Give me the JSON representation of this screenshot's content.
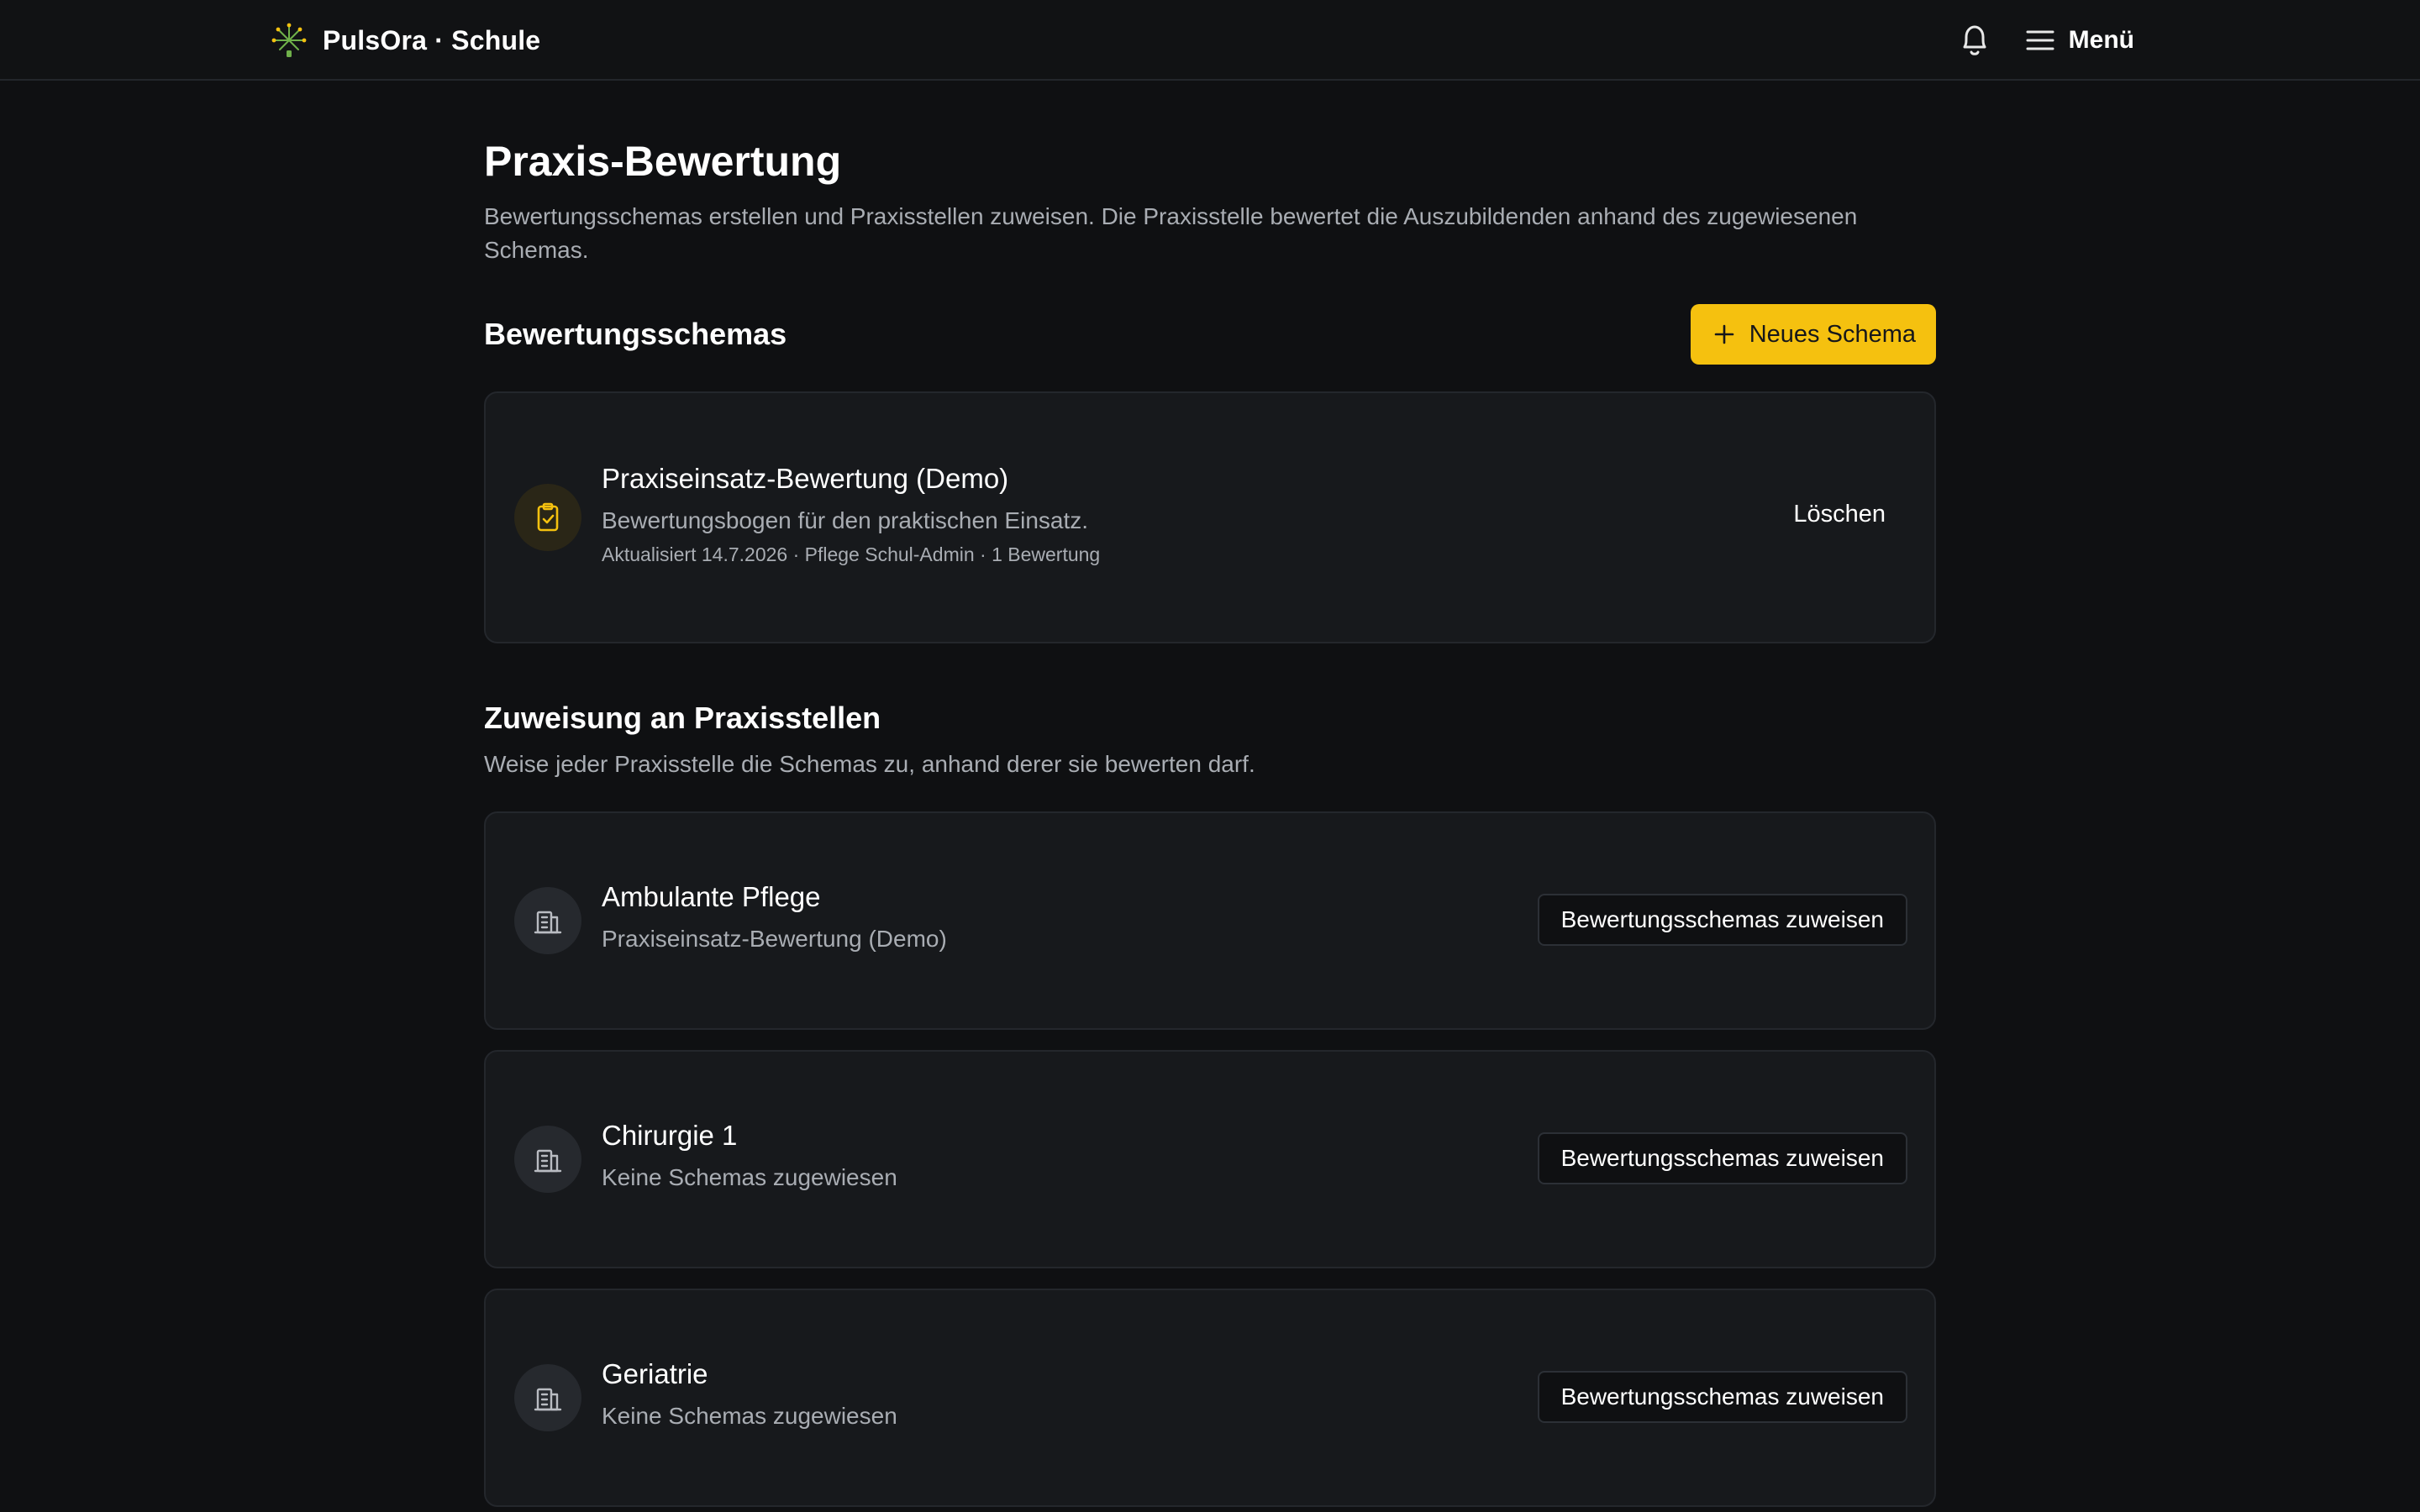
{
  "header": {
    "brand": "PulsOra · Schule",
    "notifications_icon": "bell-icon",
    "menu_icon": "hamburger-icon",
    "menu_label": "Menü"
  },
  "page": {
    "title": "Praxis-Bewertung",
    "description": "Bewertungsschemas erstellen und Praxisstellen zuweisen. Die Praxisstelle bewertet die Auszubildenden anhand des zugewiesenen Schemas."
  },
  "schemas_section": {
    "title": "Bewertungsschemas",
    "new_button_label": "Neues Schema",
    "items": [
      {
        "icon": "clipboard-check-icon",
        "title": "Praxiseinsatz-Bewertung (Demo)",
        "description": "Bewertungsbogen für den praktischen Einsatz.",
        "meta": "Aktualisiert 14.7.2026 · Pflege Schul-Admin · 1 Bewertung",
        "delete_label": "Löschen"
      }
    ]
  },
  "assignment_section": {
    "title": "Zuweisung an Praxisstellen",
    "description": "Weise jeder Praxisstelle die Schemas zu, anhand derer sie bewerten darf.",
    "items": [
      {
        "icon": "building-icon",
        "title": "Ambulante Pflege",
        "subtitle": "Praxiseinsatz-Bewertung (Demo)",
        "button_label": "Bewertungsschemas zuweisen"
      },
      {
        "icon": "building-icon",
        "title": "Chirurgie 1",
        "subtitle": "Keine Schemas zugewiesen",
        "button_label": "Bewertungsschemas zuweisen"
      },
      {
        "icon": "building-icon",
        "title": "Geriatrie",
        "subtitle": "Keine Schemas zugewiesen",
        "button_label": "Bewertungsschemas zuweisen"
      }
    ]
  },
  "colors": {
    "background": "#0f1012",
    "card": "#17191c",
    "accent": "#f5c10f",
    "text_muted": "#a9adb3"
  }
}
